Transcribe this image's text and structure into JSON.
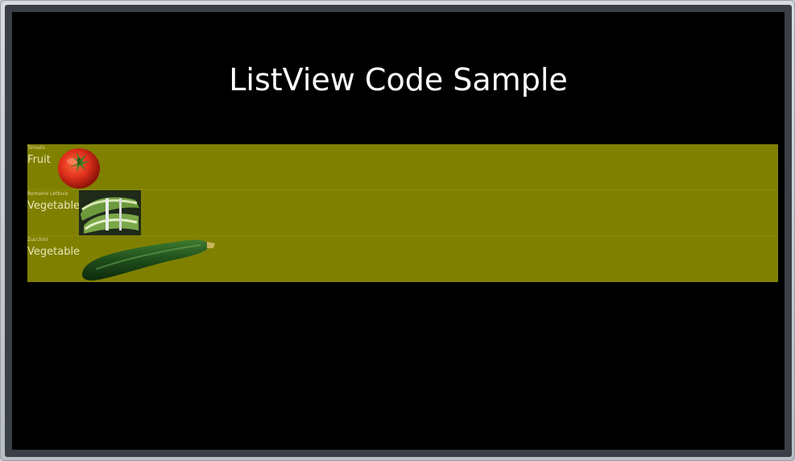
{
  "window": {
    "title": "ListView Code Sample"
  },
  "colors": {
    "background": "#000000",
    "list_background": "#808000",
    "title_text": "#ffffff"
  },
  "list": {
    "items": [
      {
        "name": "Tomato",
        "type": "Fruit",
        "image_icon": "tomato-image"
      },
      {
        "name": "Romaine Lettuce",
        "type": "Vegetable",
        "image_icon": "lettuce-image"
      },
      {
        "name": "Zucchini",
        "type": "Vegetable",
        "image_icon": "zucchini-image"
      }
    ]
  }
}
